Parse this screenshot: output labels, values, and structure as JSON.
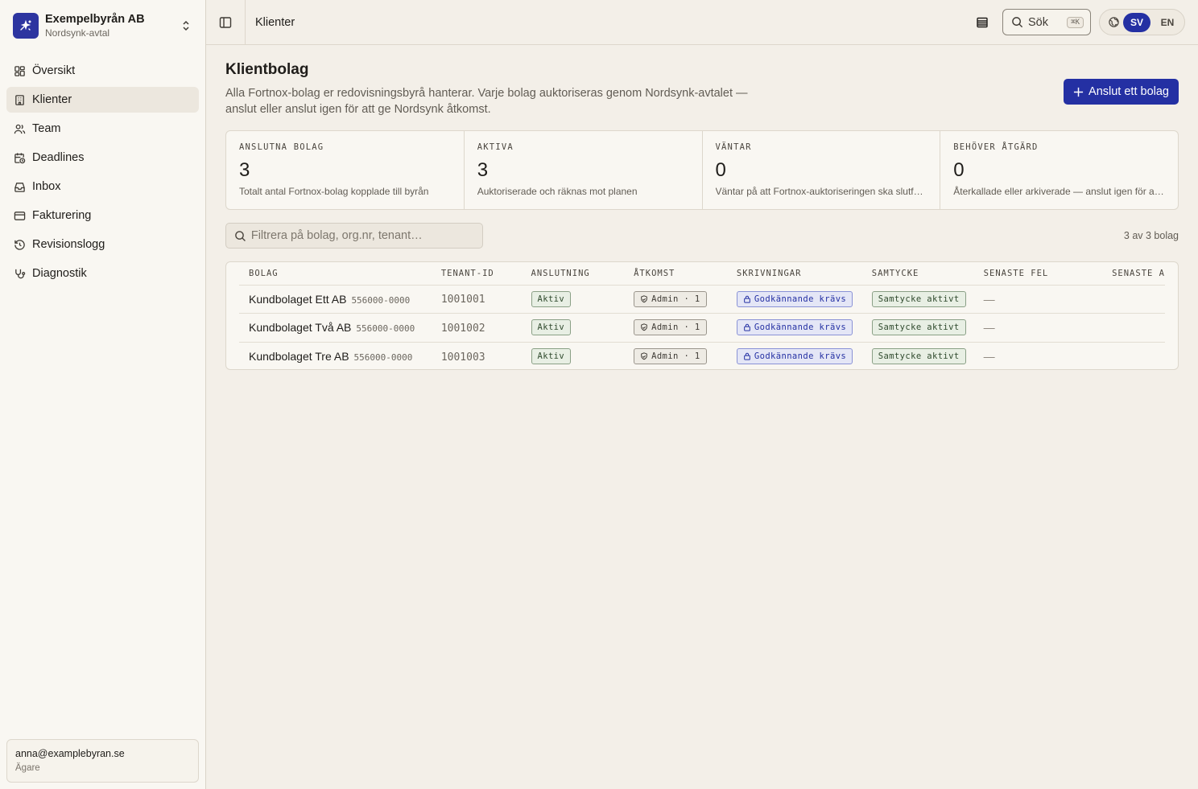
{
  "org": {
    "name": "Exempelbyrån AB",
    "subtitle": "Nordsynk-avtal"
  },
  "nav": [
    {
      "label": "Översikt",
      "icon": "dashboard-icon"
    },
    {
      "label": "Klienter",
      "icon": "building-icon",
      "active": true
    },
    {
      "label": "Team",
      "icon": "users-icon"
    },
    {
      "label": "Deadlines",
      "icon": "calendar-clock-icon"
    },
    {
      "label": "Inbox",
      "icon": "inbox-icon"
    },
    {
      "label": "Fakturering",
      "icon": "credit-card-icon"
    },
    {
      "label": "Revisionslogg",
      "icon": "history-icon"
    },
    {
      "label": "Diagnostik",
      "icon": "stethoscope-icon"
    }
  ],
  "user": {
    "email": "anna@examplebyran.se",
    "role": "Ägare"
  },
  "topbar": {
    "title": "Klienter",
    "search_label": "Sök",
    "search_kbd": "⌘K",
    "lang_sv": "SV",
    "lang_en": "EN"
  },
  "page": {
    "title": "Klientbolag",
    "description": "Alla Fortnox-bolag er redovisningsbyrå hanterar. Varje bolag auktoriseras genom Nordsynk-avtalet — anslut eller anslut igen för att ge Nordsynk åtkomst.",
    "primary_button": "Anslut ett bolag"
  },
  "stats": [
    {
      "label": "ANSLUTNA BOLAG",
      "value": "3",
      "sub": "Totalt antal Fortnox-bolag kopplade till byrån"
    },
    {
      "label": "AKTIVA",
      "value": "3",
      "sub": "Auktoriserade och räknas mot planen"
    },
    {
      "label": "VÄNTAR",
      "value": "0",
      "sub": "Väntar på att Fortnox-auktoriseringen ska slutföras"
    },
    {
      "label": "BEHÖVER ÅTGÄRD",
      "value": "0",
      "sub": "Återkallade eller arkiverade — anslut igen för att återställa"
    }
  ],
  "filter": {
    "placeholder": "Filtrera på bolag, org.nr, tenant…",
    "count": "3 av 3 bolag"
  },
  "table": {
    "headers": [
      "BOLAG",
      "TENANT-ID",
      "ANSLUTNING",
      "ÅTKOMST",
      "SKRIVNINGAR",
      "SAMTYCKE",
      "SENASTE FEL",
      "SENASTE A"
    ],
    "rows": [
      {
        "name": "Kundbolaget Ett AB",
        "org": "556000-0000",
        "tenant": "1001001",
        "status": "Aktiv",
        "access": "Admin · 1",
        "writes": "Godkännande krävs",
        "consent": "Samtycke aktivt",
        "last_error": "—"
      },
      {
        "name": "Kundbolaget Två AB",
        "org": "556000-0000",
        "tenant": "1001002",
        "status": "Aktiv",
        "access": "Admin · 1",
        "writes": "Godkännande krävs",
        "consent": "Samtycke aktivt",
        "last_error": "—"
      },
      {
        "name": "Kundbolaget Tre AB",
        "org": "556000-0000",
        "tenant": "1001003",
        "status": "Aktiv",
        "access": "Admin · 1",
        "writes": "Godkännande krävs",
        "consent": "Samtycke aktivt",
        "last_error": "—"
      }
    ]
  }
}
